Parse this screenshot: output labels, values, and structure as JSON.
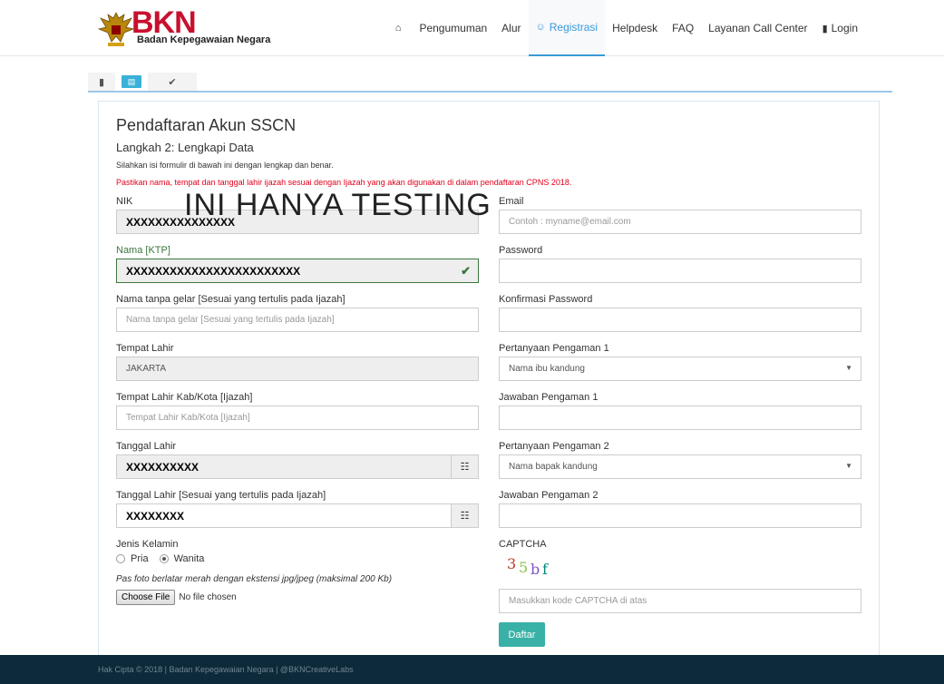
{
  "header": {
    "logo_text": "BKN",
    "logo_subtitle": "Badan Kepegawaian Negara",
    "nav": [
      {
        "label": "",
        "icon": "home-icon",
        "glyph": "⌂"
      },
      {
        "label": "Pengumuman"
      },
      {
        "label": "Alur"
      },
      {
        "label": "Registrasi",
        "icon": "user-plus-icon",
        "glyph": "☺"
      },
      {
        "label": "Helpdesk"
      },
      {
        "label": "FAQ"
      },
      {
        "label": "Layanan Call Center"
      },
      {
        "label": "Login",
        "icon": "lock-icon",
        "glyph": "▮"
      }
    ],
    "active_nav": "Registrasi"
  },
  "steps": {
    "step1_icon": "lock-icon",
    "step1_glyph": "▮",
    "step2_icon": "id-card-icon",
    "step2_glyph": "▤",
    "step3_icon": "check-icon",
    "step3_glyph": "✔"
  },
  "form": {
    "title": "Pendaftaran Akun SSCN",
    "subtitle": "Langkah 2: Lengkapi Data",
    "info": "Silahkan isi formulir di bawah ini dengan lengkap dan benar.",
    "warning": "Pastikan nama, tempat dan tanggal lahir ijazah sesuai dengan Ijazah yang akan digunakan di dalam pendaftaran CPNS 2018.",
    "watermark": "INI HANYA TESTING",
    "nik": {
      "label": "NIK",
      "value": "XXXXXXXXXXXXXXX"
    },
    "nama_ktp": {
      "label": "Nama [KTP]",
      "value": "XXXXXXXXXXXXXXXXXXXXXXXX",
      "check_glyph": "✔"
    },
    "nama_gelar": {
      "label": "Nama tanpa gelar [Sesuai yang tertulis pada Ijazah]",
      "placeholder": "Nama tanpa gelar [Sesuai yang tertulis pada Ijazah]"
    },
    "tempat_lahir": {
      "label": "Tempat Lahir",
      "value": "JAKARTA"
    },
    "tempat_lahir_ijazah": {
      "label": "Tempat Lahir Kab/Kota [Ijazah]",
      "placeholder": "Tempat Lahir Kab/Kota [Ijazah]"
    },
    "tanggal_lahir": {
      "label": "Tanggal Lahir",
      "value": "XXXXXXXXXX",
      "calendar_glyph": "☷"
    },
    "tanggal_lahir_ijazah": {
      "label": "Tanggal Lahir [Sesuai yang tertulis pada Ijazah]",
      "value": "XXXXXXXX",
      "calendar_glyph": "☷"
    },
    "jenis_kelamin": {
      "label": "Jenis Kelamin",
      "options": [
        "Pria",
        "Wanita"
      ],
      "selected": "Wanita"
    },
    "photo_note": "Pas foto berlatar merah dengan ekstensi jpg/jpeg (maksimal 200 Kb)",
    "file_button": "Choose File",
    "file_status": "No file chosen",
    "email": {
      "label": "Email",
      "placeholder": "Contoh : myname@email.com"
    },
    "password": {
      "label": "Password"
    },
    "konfirmasi_password": {
      "label": "Konfirmasi Password"
    },
    "pertanyaan1": {
      "label": "Pertanyaan Pengaman 1",
      "value": "Nama ibu kandung"
    },
    "jawaban1": {
      "label": "Jawaban Pengaman 1"
    },
    "pertanyaan2": {
      "label": "Pertanyaan Pengaman 2",
      "value": "Nama bapak kandung"
    },
    "jawaban2": {
      "label": "Jawaban Pengaman 2"
    },
    "captcha": {
      "label": "CAPTCHA",
      "chars": [
        "3",
        "5",
        "b",
        "f"
      ],
      "colors": [
        "#c0392b",
        "#8bc34a",
        "#7e57c2",
        "#00897b"
      ],
      "placeholder": "Masukkan kode CAPTCHA di atas"
    },
    "submit": "Daftar"
  },
  "footer": {
    "text": "Hak Cipta © 2018 | Badan Kepegawaian Negara | @BKNCreativeLabs"
  },
  "colors": {
    "accent": "#3a9ad9",
    "submit": "#3ab1a6",
    "warning": "#e0001b",
    "footer_bg": "#0d2a3a"
  }
}
